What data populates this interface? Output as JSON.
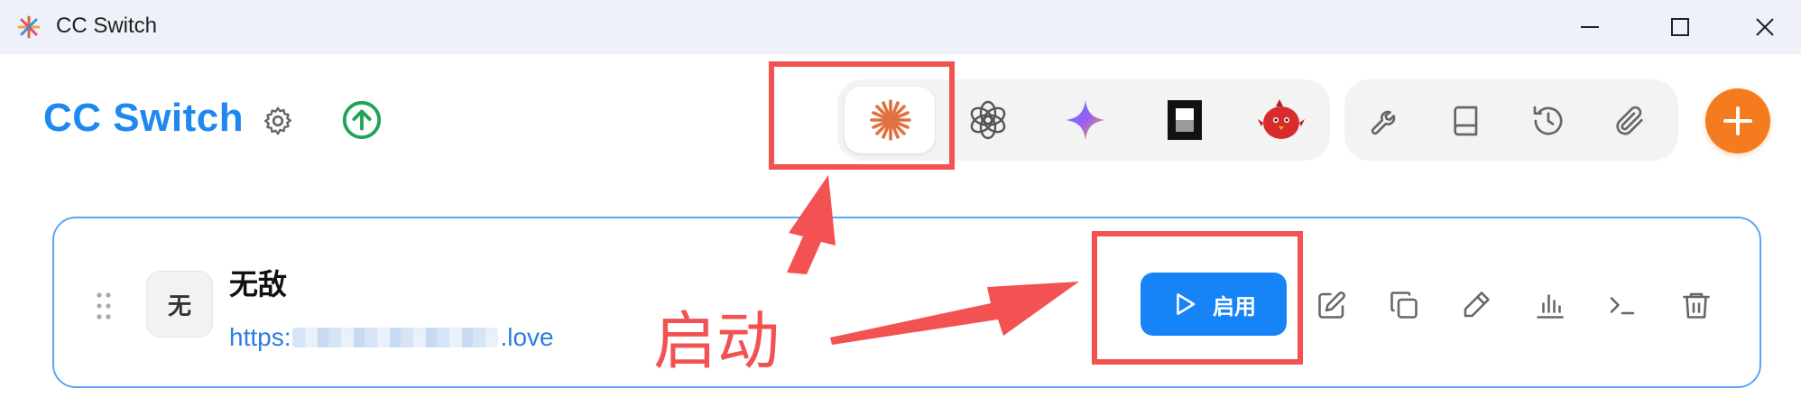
{
  "window": {
    "title": "CC Switch",
    "app_icon": "starburst-icon",
    "controls": [
      "minimize-icon",
      "maximize-icon",
      "close-icon"
    ]
  },
  "header": {
    "brand": "CC Switch",
    "settings_icon": "gear-icon",
    "update_icon": "arrow-up-circle-icon"
  },
  "provider_tabs": [
    {
      "name": "claude",
      "icon": "claude-starburst-icon",
      "active": true
    },
    {
      "name": "openai",
      "icon": "openai-knot-icon",
      "active": false
    },
    {
      "name": "gemini",
      "icon": "gemini-sparkle-icon",
      "active": false
    },
    {
      "name": "opencode",
      "icon": "opencode-square-icon",
      "active": false
    },
    {
      "name": "red-bird",
      "icon": "red-bird-icon",
      "active": false
    }
  ],
  "tools": [
    {
      "icon": "wrench-icon"
    },
    {
      "icon": "book-icon"
    },
    {
      "icon": "history-icon"
    },
    {
      "icon": "paperclip-icon"
    }
  ],
  "add_button": {
    "icon": "plus-icon",
    "color": "#f47b20"
  },
  "provider_card": {
    "avatar_text": "无",
    "name": "无敌",
    "url_prefix": "https:",
    "url_suffix": ".love",
    "enable_label": "启用",
    "actions": [
      "edit-icon",
      "copy-icon",
      "pen-icon",
      "bar-chart-icon",
      "terminal-icon",
      "trash-icon"
    ]
  },
  "annotation": {
    "text": "启动",
    "color": "#f25252"
  },
  "colors": {
    "brand": "#1e88f0",
    "primary_button": "#1684f7",
    "card_border": "#5aa6f2",
    "titlebar": "#eef1f9"
  }
}
